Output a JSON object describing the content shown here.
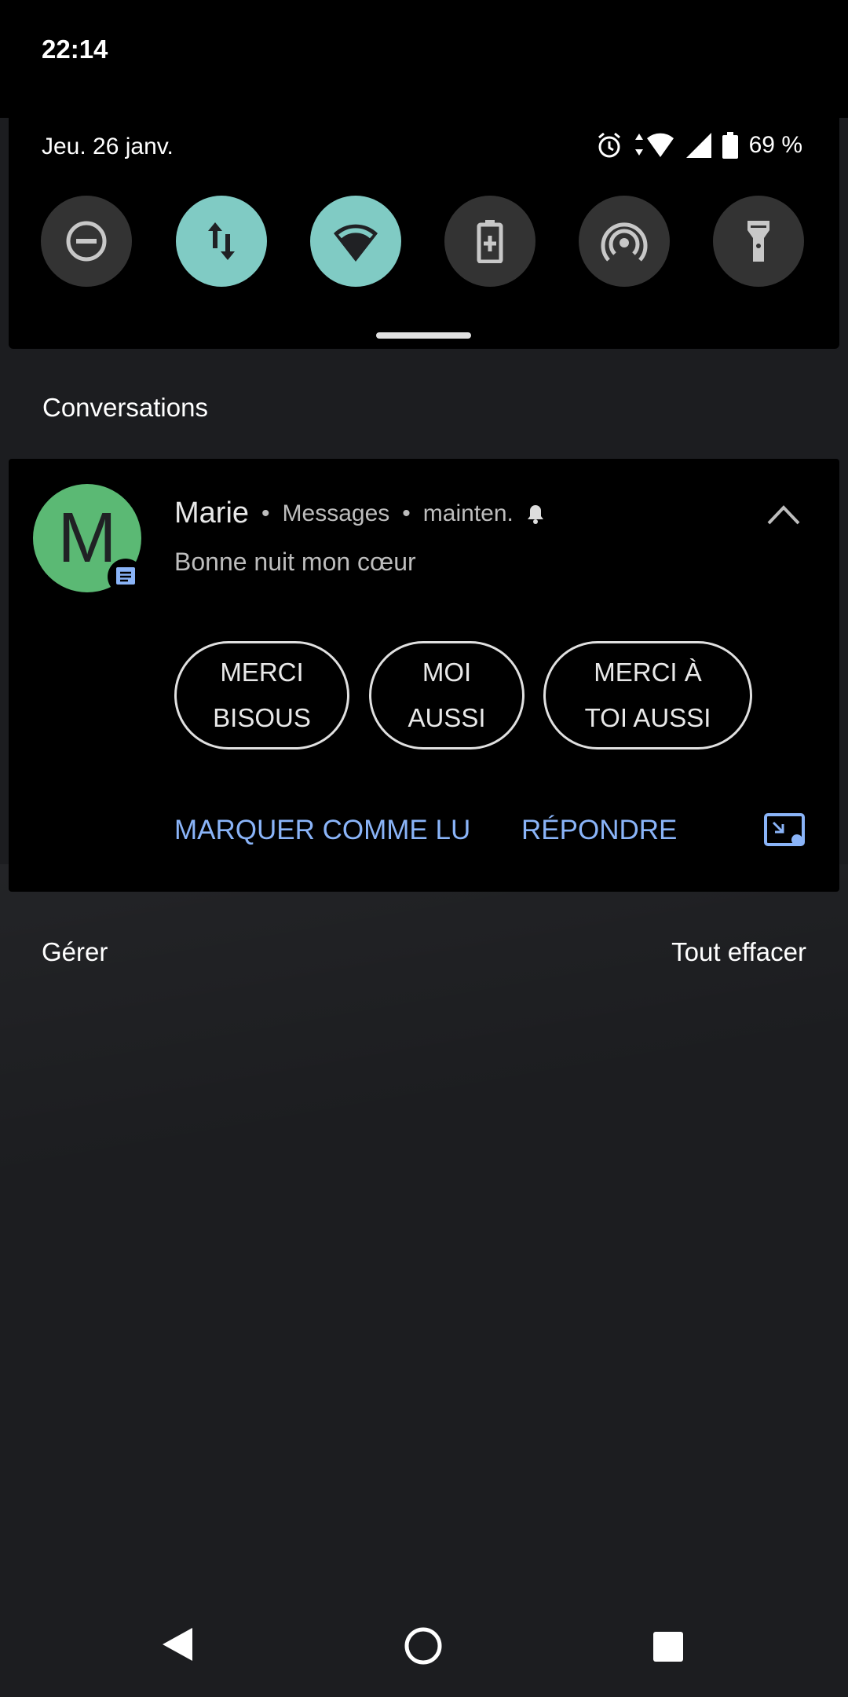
{
  "status_bar": {
    "time": "22:14",
    "date": "Jeu. 26 janv.",
    "battery": "69 %",
    "icons": [
      "alarm-icon",
      "data-arrows-icon",
      "wifi-icon",
      "signal-icon",
      "battery-icon"
    ]
  },
  "quick_settings": {
    "tiles": [
      {
        "name": "do-not-disturb",
        "icon": "do-not-disturb-icon",
        "on": false
      },
      {
        "name": "mobile-data",
        "icon": "mobile-data-icon",
        "on": true
      },
      {
        "name": "wifi",
        "icon": "wifi-icon",
        "on": true
      },
      {
        "name": "battery-saver",
        "icon": "battery-saver-icon",
        "on": false
      },
      {
        "name": "hotspot",
        "icon": "hotspot-icon",
        "on": false
      },
      {
        "name": "flashlight",
        "icon": "flashlight-icon",
        "on": false
      }
    ],
    "accent": "#80cbc4"
  },
  "section_title": "Conversations",
  "notification": {
    "avatar_letter": "M",
    "avatar_color": "#5bb974",
    "sender": "Marie",
    "app": "Messages",
    "time": "mainten.",
    "separator": "•",
    "message": "Bonne nuit mon cœur",
    "smart_replies": [
      "MERCI\nBISOUS",
      "MOI\nAUSSI",
      "MERCI À\nTOI AUSSI"
    ],
    "actions": [
      "MARQUER COMME LU",
      "RÉPONDRE"
    ],
    "action_color": "#8ab4f8"
  },
  "footer": {
    "manage": "Gérer",
    "clear_all": "Tout effacer"
  }
}
